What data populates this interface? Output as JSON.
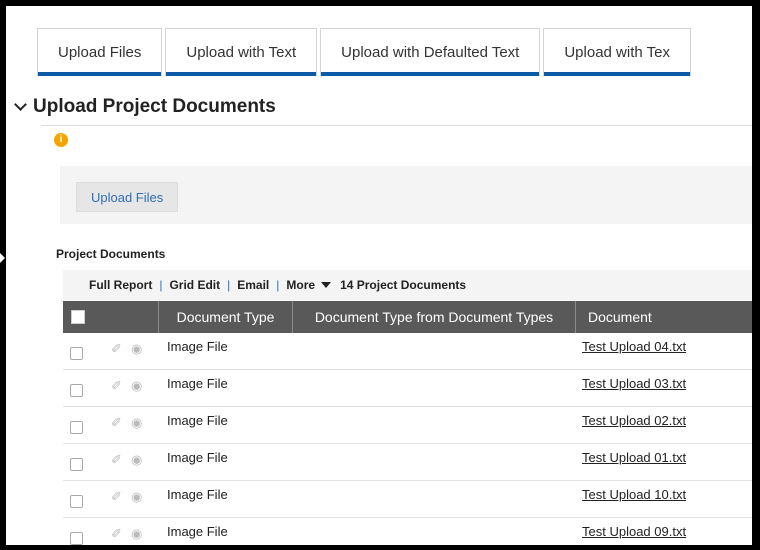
{
  "tabs": [
    {
      "label": "Upload Files",
      "active": true
    },
    {
      "label": "Upload with Text"
    },
    {
      "label": "Upload with Defaulted Text"
    },
    {
      "label": "Upload with Tex"
    }
  ],
  "section": {
    "title": "Upload Project Documents",
    "info_icon": "i"
  },
  "upload": {
    "button_label": "Upload Files"
  },
  "project_docs": {
    "title": "Project Documents",
    "toolbar": {
      "full_report": "Full Report",
      "grid_edit": "Grid Edit",
      "email": "Email",
      "more": "More",
      "count": "14 Project Documents",
      "separator": "|"
    },
    "columns": [
      "Document Type",
      "Document Type from Document Types",
      "Document"
    ],
    "rows": [
      {
        "type": "Image File",
        "type_from": "",
        "document": "Test Upload 04.txt"
      },
      {
        "type": "Image File",
        "type_from": "",
        "document": "Test Upload 03.txt"
      },
      {
        "type": "Image File",
        "type_from": "",
        "document": "Test Upload 02.txt"
      },
      {
        "type": "Image File",
        "type_from": "",
        "document": "Test Upload 01.txt"
      },
      {
        "type": "Image File",
        "type_from": "",
        "document": "Test Upload 10.txt"
      },
      {
        "type": "Image File",
        "type_from": "",
        "document": "Test Upload 09.txt"
      }
    ]
  },
  "icons": {
    "pencil": "✐",
    "eye": "◉"
  },
  "colors": {
    "accent": "#0d5aa7",
    "link": "#2e6fb7",
    "header_bg": "#595959",
    "info": "#f5a400"
  }
}
